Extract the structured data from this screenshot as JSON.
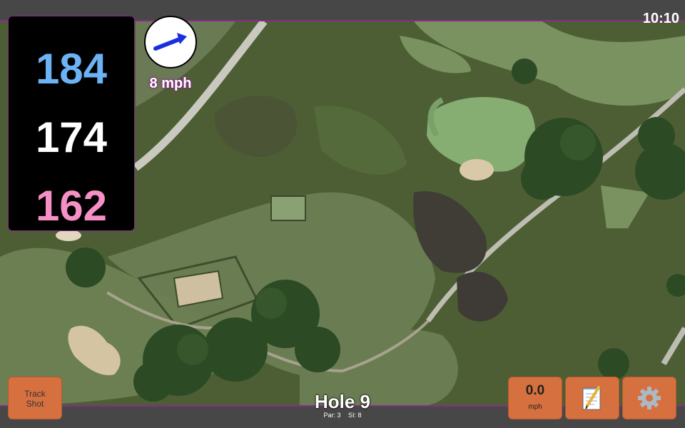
{
  "status_bar": {
    "time": "10:10"
  },
  "distances": {
    "back": "184",
    "middle": "174",
    "front": "162"
  },
  "wind": {
    "speed_label": "8 mph",
    "direction_icon": "wind-arrow-icon"
  },
  "buttons": {
    "track_shot": "Track\nShot",
    "speed_value": "0.0",
    "speed_unit": "mph",
    "notes_icon": "notepad-icon",
    "settings_icon": "gear-icon"
  },
  "hole": {
    "title": "Hole 9",
    "par": "Par: 3",
    "si": "SI: 8"
  },
  "colors": {
    "accent": "#8a2b8a",
    "button": "#d6703f",
    "back": "#6bb3f4",
    "front": "#f58fc5"
  }
}
